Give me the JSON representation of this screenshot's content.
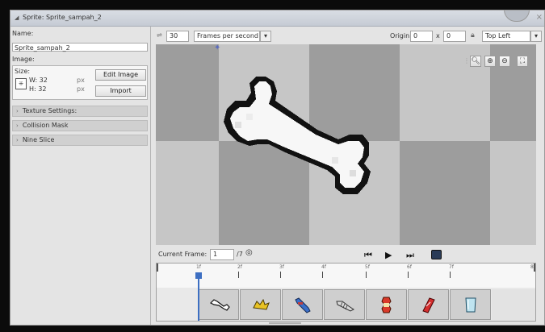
{
  "window": {
    "title": "Sprite: Sprite_sampah_2",
    "close_glyph": "×"
  },
  "left_panel": {
    "name_label": "Name:",
    "name_value": "Sprite_sampah_2",
    "image_label": "Image:",
    "size_label": "Size:",
    "width_text": "W: 32",
    "height_text": "H: 32",
    "px_unit": "px",
    "edit_image_label": "Edit Image",
    "import_label": "Import",
    "sections": [
      "Texture Settings:",
      "Collision Mask",
      "Nine Slice"
    ]
  },
  "toolbar": {
    "speed_value": "30",
    "speed_mode": "Frames per second",
    "origin_label": "Origin",
    "origin_x": "0",
    "origin_x_label": "x",
    "origin_y": "0",
    "origin_preset": "Top Left"
  },
  "frame_controls": {
    "current_frame_label": "Current Frame:",
    "current_frame_value": "1",
    "total_frames": "/7"
  },
  "timeline": {
    "tick_labels": [
      "1f",
      "2f",
      "3f",
      "4f",
      "5f",
      "6f",
      "7f",
      "8"
    ],
    "frames": [
      {
        "icon": "bone-icon"
      },
      {
        "icon": "banana-peel-icon"
      },
      {
        "icon": "blue-bottle-icon"
      },
      {
        "icon": "fish-bone-icon"
      },
      {
        "icon": "apple-core-icon"
      },
      {
        "icon": "red-can-icon"
      },
      {
        "icon": "plastic-cup-icon"
      }
    ],
    "current_frame_index": 0
  },
  "colors": {
    "accent": "#3d6fc2",
    "canvas_light": "#c9c9c9",
    "canvas_dark": "#9d9d9d"
  }
}
